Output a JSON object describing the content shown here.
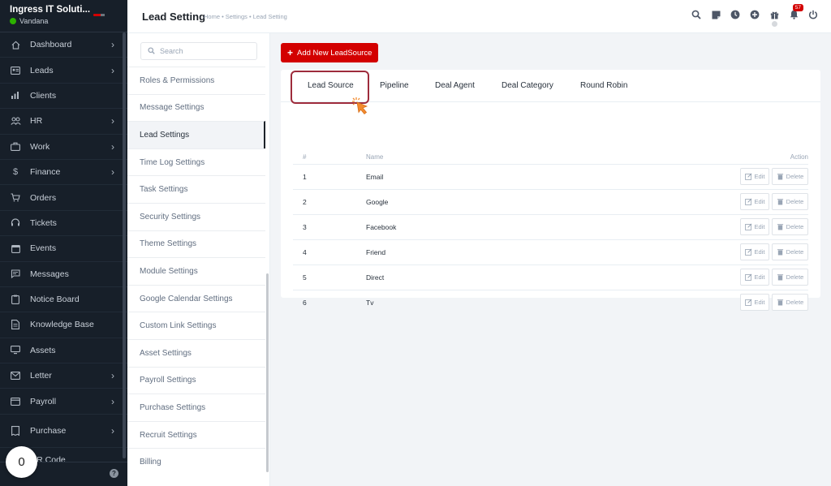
{
  "app": {
    "company": "Ingress IT Soluti...",
    "user": "Vandana",
    "colors": {
      "sidebar": "#171f29",
      "accent": "#d30000",
      "active_tab_border": "#9e2c3c",
      "online": "#2cb100"
    }
  },
  "sidebar": {
    "items": [
      {
        "label": "Dashboard",
        "icon": "home-icon",
        "has_submenu": true
      },
      {
        "label": "Leads",
        "icon": "id-card-icon",
        "has_submenu": true
      },
      {
        "label": "Clients",
        "icon": "bar-chart-icon",
        "has_submenu": false
      },
      {
        "label": "HR",
        "icon": "people-icon",
        "has_submenu": true
      },
      {
        "label": "Work",
        "icon": "briefcase-icon",
        "has_submenu": true
      },
      {
        "label": "Finance",
        "icon": "dollar-icon",
        "has_submenu": true
      },
      {
        "label": "Orders",
        "icon": "cart-icon",
        "has_submenu": false
      },
      {
        "label": "Tickets",
        "icon": "headset-icon",
        "has_submenu": false
      },
      {
        "label": "Events",
        "icon": "calendar-icon",
        "has_submenu": false
      },
      {
        "label": "Messages",
        "icon": "chat-icon",
        "has_submenu": false
      },
      {
        "label": "Notice Board",
        "icon": "clipboard-icon",
        "has_submenu": false
      },
      {
        "label": "Knowledge Base",
        "icon": "document-icon",
        "has_submenu": false
      },
      {
        "label": "Assets",
        "icon": "monitor-icon",
        "has_submenu": false
      },
      {
        "label": "Letter",
        "icon": "envelope-icon",
        "has_submenu": true
      },
      {
        "label": "Payroll",
        "icon": "wallet-icon",
        "has_submenu": true
      },
      {
        "label": "Purchase",
        "icon": "receipt-icon",
        "has_submenu": true
      },
      {
        "label": "QR Code",
        "icon": "qr-icon",
        "has_submenu": false
      }
    ],
    "floating_counter": "0",
    "help_icon": "question-icon"
  },
  "header": {
    "title": "Lead Setting",
    "breadcrumb": "Home • Settings • Lead Setting",
    "icons": [
      "search-icon",
      "sticky-note-icon",
      "clock-icon",
      "plus-circle-icon",
      "gift-icon",
      "bell-icon",
      "power-icon"
    ],
    "notification_count": "57"
  },
  "settings_menu": {
    "search_placeholder": "Search",
    "items": [
      "Roles & Permissions",
      "Message Settings",
      "Lead Settings",
      "Time Log Settings",
      "Task Settings",
      "Security Settings",
      "Theme Settings",
      "Module Settings",
      "Google Calendar Settings",
      "Custom Link Settings",
      "Asset Settings",
      "Payroll Settings",
      "Purchase Settings",
      "Recruit Settings",
      "Billing"
    ],
    "active": "Lead Settings"
  },
  "content": {
    "add_button": "Add New LeadSource",
    "tabs": [
      "Lead Source",
      "Pipeline",
      "Deal Agent",
      "Deal Category",
      "Round Robin"
    ],
    "active_tab": "Lead Source",
    "table": {
      "headers": {
        "num": "#",
        "name": "Name",
        "action": "Action"
      },
      "rows": [
        {
          "num": "1",
          "name": "Email"
        },
        {
          "num": "2",
          "name": "Google"
        },
        {
          "num": "3",
          "name": "Facebook"
        },
        {
          "num": "4",
          "name": "Friend"
        },
        {
          "num": "5",
          "name": "Direct"
        },
        {
          "num": "6",
          "name": "Tv"
        }
      ],
      "edit_label": "Edit",
      "delete_label": "Delete"
    }
  }
}
